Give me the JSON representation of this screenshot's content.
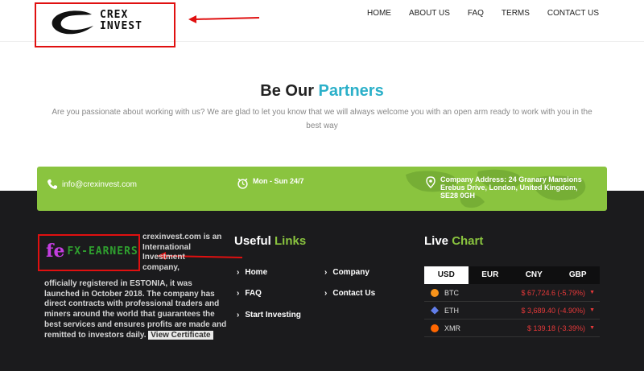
{
  "header": {
    "logo_line1": "CREX",
    "logo_line2": "INVEST",
    "nav": [
      "HOME",
      "ABOUT US",
      "FAQ",
      "TERMS",
      "CONTACT US"
    ]
  },
  "partners": {
    "title_main": "Be Our ",
    "title_accent": "Partners",
    "description": "Are you passionate about working with us? We are glad to let you know that we will always welcome you with an open arm ready to work with you in the best way"
  },
  "contact": {
    "email": "info@crexinvest.com",
    "hours": "Mon - Sun 24/7",
    "address": "Company Address: 24 Granary Mansions Erebus Drive, London, United Kingdom, SE28 0GH"
  },
  "about": {
    "badge_letter": "fe",
    "badge_text": "FX-EARNERS",
    "text_top": "crexinvest.com is an International Investment company,",
    "text_rest": "officially registered in ESTONIA, it was launched in October 2018. The company has direct contracts with professional traders and miners around the world that guarantees the best services and ensures profits are made and remitted to investors daily.",
    "certificate_label": "View Certificate"
  },
  "links": {
    "title_main": "Useful ",
    "title_accent": "Links",
    "items": [
      "Home",
      "Company",
      "FAQ",
      "Contact Us",
      "Start Investing"
    ]
  },
  "chart": {
    "title_main": "Live ",
    "title_accent": "Chart",
    "tabs": [
      "USD",
      "EUR",
      "CNY",
      "GBP"
    ],
    "rows": [
      {
        "coin": "BTC",
        "price": "$ 67,724.6 (-5.79%)",
        "color": "#f7931a"
      },
      {
        "coin": "ETH",
        "price": "$ 3,689.40 (-4.90%)",
        "color": "#627eea"
      },
      {
        "coin": "XMR",
        "price": "$ 139.18 (-3.39%)",
        "color": "#ff6600"
      }
    ]
  },
  "colors": {
    "accent_teal": "#2bb0c9",
    "accent_green": "#8ac43f",
    "annotation_red": "#e01010"
  }
}
